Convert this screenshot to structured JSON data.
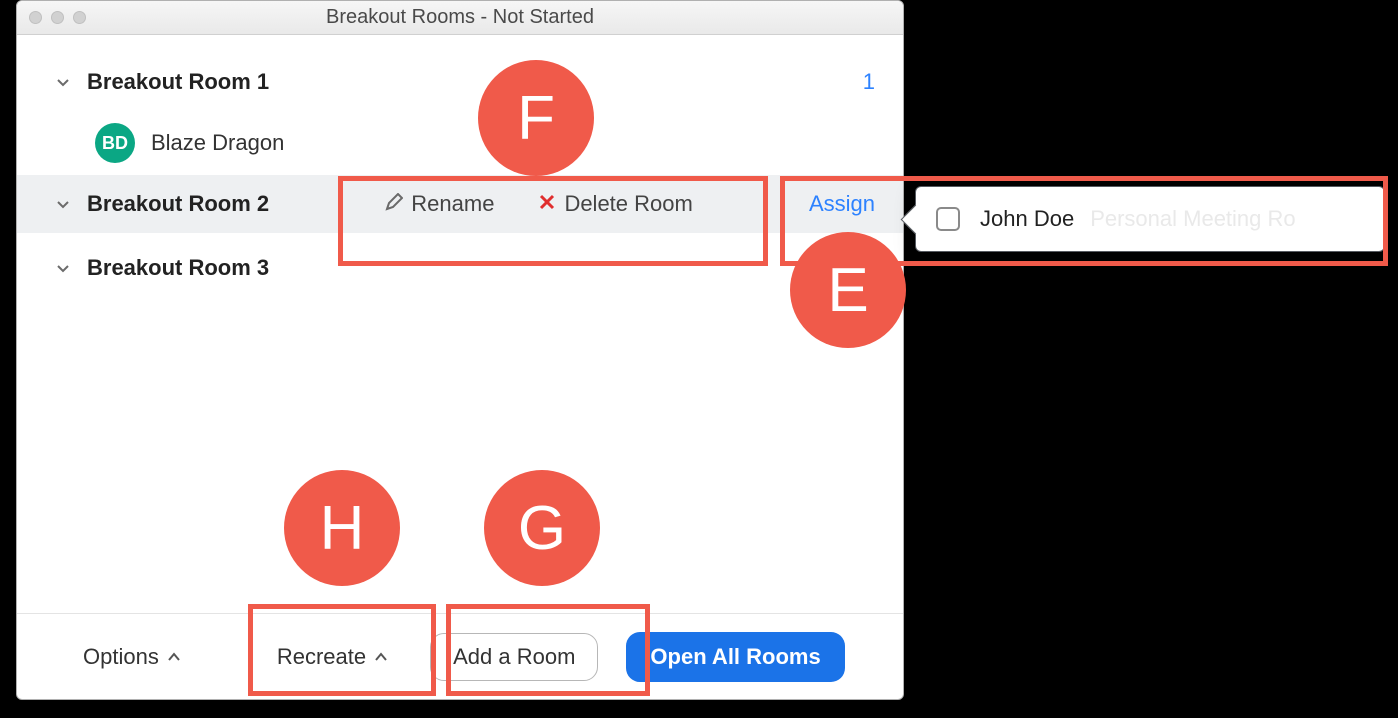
{
  "window": {
    "title": "Breakout Rooms - Not Started"
  },
  "rooms": [
    {
      "name": "Breakout Room 1",
      "count": "1",
      "participants": [
        {
          "initials": "BD",
          "name": "Blaze  Dragon"
        }
      ]
    },
    {
      "name": "Breakout Room 2",
      "actions": {
        "rename": "Rename",
        "delete": "Delete Room",
        "assign": "Assign"
      }
    },
    {
      "name": "Breakout Room 3"
    }
  ],
  "popover": {
    "checked": false,
    "name": "John Doe",
    "extra": "Personal Meeting Ro"
  },
  "footer": {
    "options": "Options",
    "recreate": "Recreate",
    "add_room": "Add a Room",
    "open_all": "Open All Rooms"
  },
  "annotations": {
    "E": "E",
    "F": "F",
    "G": "G",
    "H": "H"
  }
}
